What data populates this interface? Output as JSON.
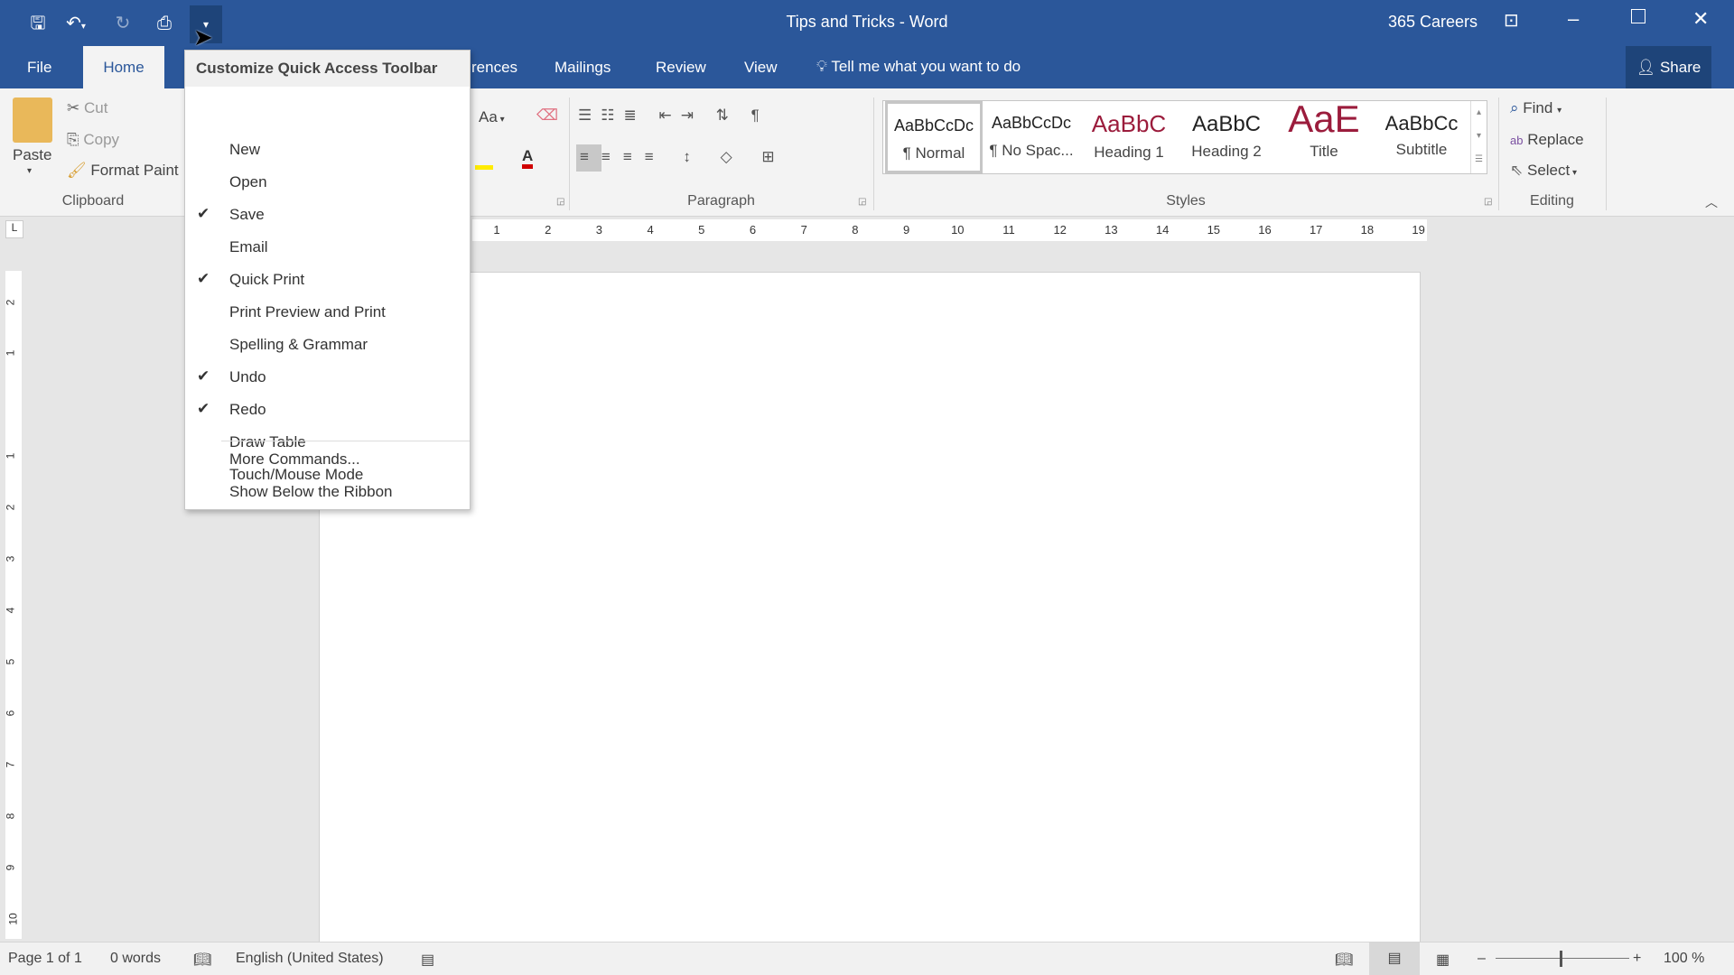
{
  "window": {
    "title": "Tips and Tricks - Word",
    "user": "365 Careers"
  },
  "qat": {
    "save_icon": "save-icon",
    "undo_icon": "undo-icon",
    "redo_icon": "redo-icon",
    "quick_print_icon": "quick-print-icon",
    "customize_icon": "chevron-down-icon"
  },
  "tabs": [
    {
      "label": "File"
    },
    {
      "label": "Home"
    },
    {
      "label": "rences"
    },
    {
      "label": "Mailings"
    },
    {
      "label": "Review"
    },
    {
      "label": "View"
    }
  ],
  "tell_me": "Tell me what you want to do",
  "share": "Share",
  "clipboard": {
    "label": "Clipboard",
    "paste": "Paste",
    "cut": "Cut",
    "copy": "Copy",
    "format_painter": "Format Paint"
  },
  "font": {
    "change_case": "Aa"
  },
  "paragraph": {
    "label": "Paragraph"
  },
  "styles": {
    "label": "Styles",
    "items": [
      {
        "preview": "AaBbCcDc",
        "name": "¶ Normal",
        "color": "#222222"
      },
      {
        "preview": "AaBbCcDc",
        "name": "¶ No Spac...",
        "color": "#222222"
      },
      {
        "preview": "AaBbC",
        "name": "Heading 1",
        "color": "#9b1c3c"
      },
      {
        "preview": "AaBbC",
        "name": "Heading 2",
        "color": "#333333"
      },
      {
        "preview": "AaE",
        "name": "Title",
        "color": "#9b1c3c"
      },
      {
        "preview": "AaBbCc",
        "name": "Subtitle",
        "color": "#333333"
      }
    ]
  },
  "editing": {
    "label": "Editing",
    "find": "Find",
    "replace": "Replace",
    "select": "Select"
  },
  "ruler": {
    "h": [
      "1",
      "2",
      "3",
      "4",
      "5",
      "6",
      "7",
      "8",
      "9",
      "10",
      "11",
      "12",
      "13",
      "14",
      "15",
      "16",
      "17",
      "18",
      "19"
    ],
    "v_top": [
      "2",
      "1"
    ],
    "v": [
      "1",
      "2",
      "3",
      "4",
      "5",
      "6",
      "7",
      "8",
      "9",
      "10"
    ]
  },
  "menu": {
    "title": "Customize Quick Access Toolbar",
    "items": [
      {
        "label": "New",
        "checked": false
      },
      {
        "label": "Open",
        "checked": false
      },
      {
        "label": "Save",
        "checked": true
      },
      {
        "label": "Email",
        "checked": false
      },
      {
        "label": "Quick Print",
        "checked": true
      },
      {
        "label": "Print Preview and Print",
        "checked": false
      },
      {
        "label": "Spelling & Grammar",
        "checked": false
      },
      {
        "label": "Undo",
        "checked": true
      },
      {
        "label": "Redo",
        "checked": true
      },
      {
        "label": "Draw Table",
        "checked": false
      },
      {
        "label": "Touch/Mouse Mode",
        "checked": false
      }
    ],
    "more": "More Commands...",
    "below": "Show Below the Ribbon"
  },
  "status": {
    "page": "Page 1 of 1",
    "words": "0 words",
    "language": "English (United States)",
    "zoom": "100 %"
  },
  "colors": {
    "brand": "#2b579a",
    "ribbon": "#f3f3f3"
  }
}
